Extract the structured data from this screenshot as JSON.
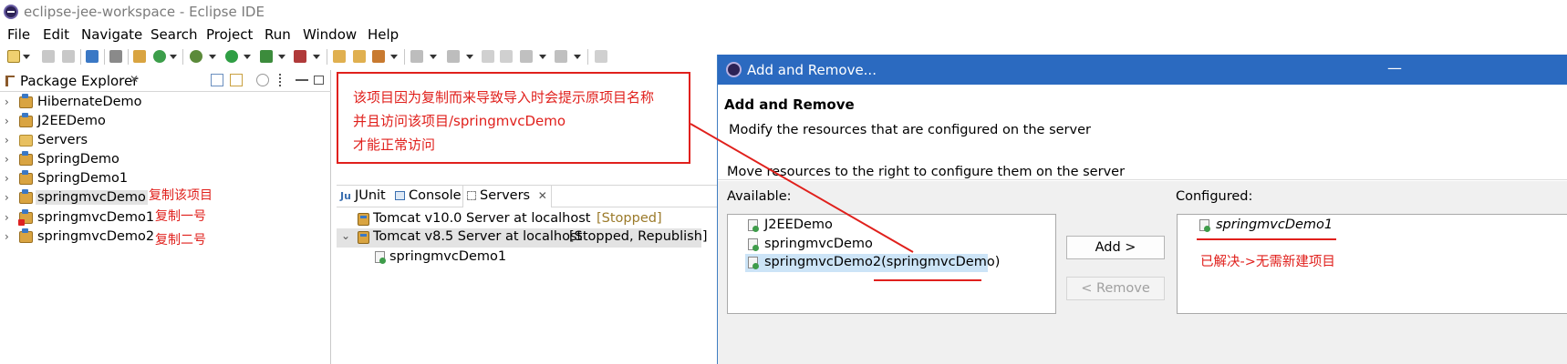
{
  "window": {
    "title": "eclipse-jee-workspace - Eclipse IDE"
  },
  "menu": [
    "File",
    "Edit",
    "Navigate",
    "Search",
    "Project",
    "Run",
    "Window",
    "Help"
  ],
  "package_explorer": {
    "title": "Package Explorer",
    "close_glyph": "✕",
    "items": [
      {
        "label": "HibernateDemo",
        "icon": "project-icon"
      },
      {
        "label": "J2EEDemo",
        "icon": "project-icon"
      },
      {
        "label": "Servers",
        "icon": "folder-icon"
      },
      {
        "label": "SpringDemo",
        "icon": "project-icon"
      },
      {
        "label": "SpringDemo1",
        "icon": "project-icon"
      },
      {
        "label": "springmvcDemo",
        "icon": "project-icon",
        "selected": true
      },
      {
        "label": "springmvcDemo1",
        "icon": "project-error-icon"
      },
      {
        "label": "springmvcDemo2",
        "icon": "project-icon"
      }
    ],
    "notes": [
      "复制该项目",
      "复制一号",
      "复制二号"
    ]
  },
  "annotation": {
    "lines": [
      "该项目因为复制而来导致导入时会提示原项目名称",
      "并且访问该项目/springmvcDemo",
      "才能正常访问"
    ]
  },
  "servers_view": {
    "tabs": [
      "JUnit",
      "Console",
      "Servers"
    ],
    "active_tab": "Servers",
    "close_glyph": "✕",
    "servers": [
      {
        "name": "Tomcat v10.0 Server at localhost",
        "status": "[Stopped]"
      },
      {
        "name": "Tomcat v8.5 Server at localhost",
        "status": "[Stopped, Republish]",
        "expanded": true,
        "selected": true,
        "children": [
          "springmvcDemo1"
        ]
      }
    ]
  },
  "dialog": {
    "title": "Add and Remove...",
    "minimize_glyph": "—",
    "heading": "Add and Remove",
    "description": "Modify the resources that are configured on the server",
    "instruction": "Move resources to the right to configure them on the server",
    "available_label": "Available:",
    "configured_label": "Configured:",
    "available": [
      "J2EEDemo",
      "springmvcDemo",
      "springmvcDemo2(springmvcDemo)"
    ],
    "available_selected": "springmvcDemo2(springmvcDemo)",
    "configured": [
      "springmvcDemo1"
    ],
    "add_label": "Add >",
    "remove_label": "< Remove",
    "resolved_note": "已解决->无需新建项目"
  },
  "colors": {
    "annotation_red": "#e0201c",
    "dialog_titlebar": "#2b6ac0",
    "selection_blue": "#cce4f7"
  }
}
